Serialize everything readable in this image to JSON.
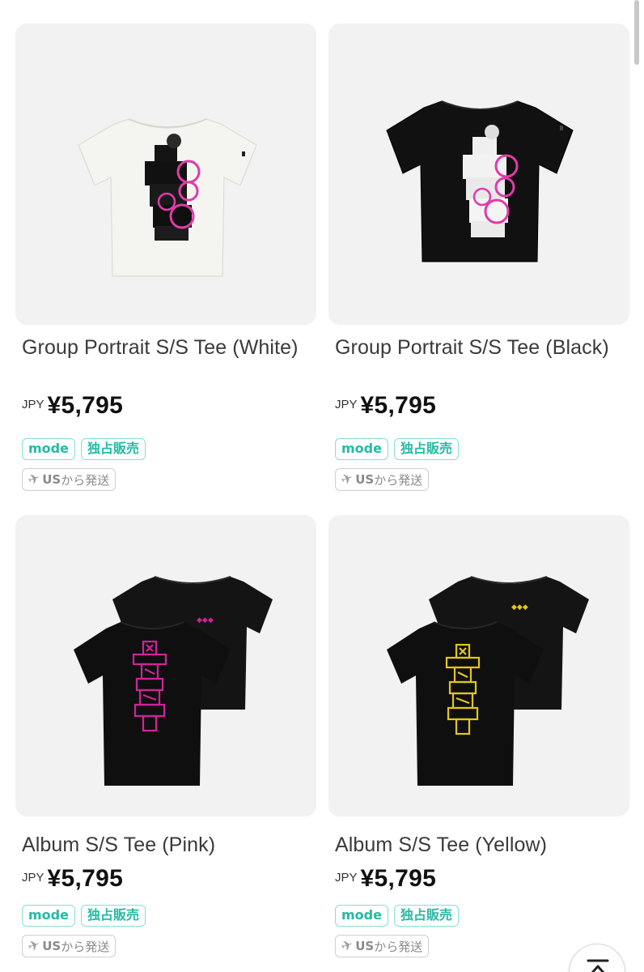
{
  "products": [
    {
      "title": "Group Portrait S/S Tee (White)",
      "currency": "JPY",
      "price": "¥5,795",
      "tags": [
        "mode",
        "独占販売"
      ],
      "ship_us": "US",
      "ship_rest": "から発送",
      "shirt_color": "#f4f4f0",
      "print_color": "#e23aa8"
    },
    {
      "title": "Group Portrait S/S Tee (Black)",
      "currency": "JPY",
      "price": "¥5,795",
      "tags": [
        "mode",
        "独占販売"
      ],
      "ship_us": "US",
      "ship_rest": "から発送",
      "shirt_color": "#111111",
      "print_color": "#e23aa8"
    },
    {
      "title": "Album S/S Tee (Pink)",
      "currency": "JPY",
      "price": "¥5,795",
      "tags": [
        "mode",
        "独占販売"
      ],
      "ship_us": "US",
      "ship_rest": "から発送",
      "shirt_color": "#111111",
      "print_color": "#d0239a"
    },
    {
      "title": "Album S/S Tee (Yellow)",
      "currency": "JPY",
      "price": "¥5,795",
      "tags": [
        "mode",
        "独占販売"
      ],
      "ship_us": "US",
      "ship_rest": "から発送",
      "shirt_color": "#111111",
      "print_color": "#e2c61a"
    }
  ],
  "icons": {
    "plane": "airplane-icon",
    "back_to_top": "arrow-up-to-top-icon"
  }
}
